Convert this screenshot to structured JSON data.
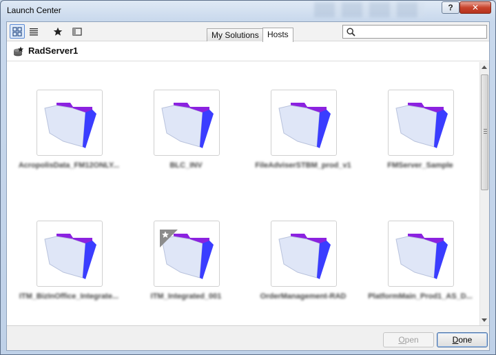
{
  "window": {
    "title": "Launch Center",
    "help_label": "?",
    "close_label": "✕"
  },
  "toolbar": {
    "view_buttons": [
      {
        "name": "grid-view-icon"
      },
      {
        "name": "list-view-icon"
      },
      {
        "name": "favorites-star-icon"
      },
      {
        "name": "panel-toggle-icon"
      }
    ],
    "tabs": [
      {
        "label": "My Solutions",
        "active": false
      },
      {
        "label": "Hosts",
        "active": true
      }
    ],
    "search": {
      "value": "",
      "placeholder": ""
    }
  },
  "host": {
    "name": "RadServer1",
    "icon": "host-server-icon"
  },
  "files": [
    {
      "label": "AcropolisData_FM12ONLY...",
      "favorite": false
    },
    {
      "label": "BLC_INV",
      "favorite": false
    },
    {
      "label": "FileAdviserSTBM_prod_v1",
      "favorite": false
    },
    {
      "label": "FMServer_Sample",
      "favorite": false
    },
    {
      "label": "ITM_BizInOffice_Integrate...",
      "favorite": false
    },
    {
      "label": "ITM_Integrated_001",
      "favorite": true
    },
    {
      "label": "OrderManagement-RAD",
      "favorite": false
    },
    {
      "label": "PlatformMain_Prod1_AS_D...",
      "favorite": false
    }
  ],
  "footer": {
    "open_label": "Open",
    "open_enabled": false,
    "done_label": "Done"
  },
  "colors": {
    "folder_purple": "#8b22e0",
    "folder_blue": "#3a3dff",
    "folder_light": "#dfe6f7",
    "selection_blue": "#5a8ad6"
  }
}
